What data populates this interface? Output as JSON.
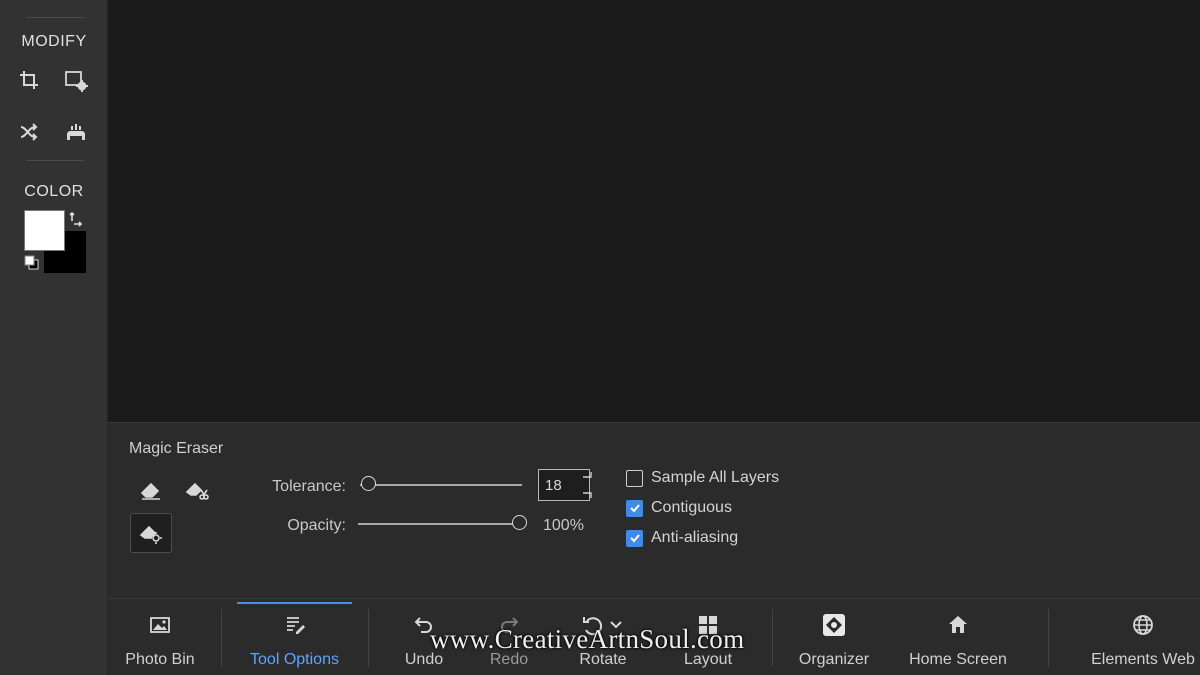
{
  "left_panel": {
    "modify_label": "MODIFY",
    "color_label": "COLOR",
    "tools": [
      {
        "name": "crop-icon"
      },
      {
        "name": "recompose-icon"
      },
      {
        "name": "content-aware-move-icon"
      },
      {
        "name": "straighten-icon"
      }
    ],
    "foreground_color": "#ffffff",
    "background_color": "#000000"
  },
  "tool_options": {
    "tool_name": "Magic Eraser",
    "tolerance_label": "Tolerance:",
    "tolerance_value": "18",
    "opacity_label": "Opacity:",
    "opacity_value": "100%",
    "checkboxes": [
      {
        "label": "Sample All Layers",
        "checked": false
      },
      {
        "label": "Contiguous",
        "checked": true
      },
      {
        "label": "Anti-aliasing",
        "checked": true
      }
    ]
  },
  "bottom_bar": {
    "items": [
      {
        "label": "Photo Bin",
        "icon": "photo-icon"
      },
      {
        "label": "Tool Options",
        "icon": "tool-options-icon",
        "active": true
      },
      {
        "label": "Undo",
        "icon": "undo-icon"
      },
      {
        "label": "Redo",
        "icon": "redo-icon",
        "disabled": true
      },
      {
        "label": "Rotate",
        "icon": "rotate-icon"
      },
      {
        "label": "Layout",
        "icon": "layout-icon"
      },
      {
        "label": "Organizer",
        "icon": "organizer-icon"
      },
      {
        "label": "Home Screen",
        "icon": "home-icon"
      },
      {
        "label": "Elements Web",
        "icon": "globe-icon"
      }
    ]
  },
  "watermark": "www.CreativeArtnSoul.com",
  "colors": {
    "accent": "#4a90e2",
    "checkbox": "#3f8be6"
  }
}
